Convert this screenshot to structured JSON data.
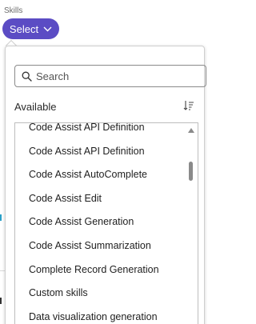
{
  "field": {
    "label": "Skills"
  },
  "select_button": {
    "label": "Select",
    "icon": "chevron-down-icon",
    "color": "#5b4cc4"
  },
  "search": {
    "placeholder": "Search",
    "value": "",
    "icon": "search-icon"
  },
  "section": {
    "label": "Available",
    "sort_icon": "sort-icon"
  },
  "list": {
    "items": [
      "Code Assist API Definition",
      "Code Assist API Definition",
      "Code Assist AutoComplete",
      "Code Assist Edit",
      "Code Assist Generation",
      "Code Assist Summarization",
      "Complete Record Generation",
      "Custom skills",
      "Data visualization generation"
    ]
  }
}
